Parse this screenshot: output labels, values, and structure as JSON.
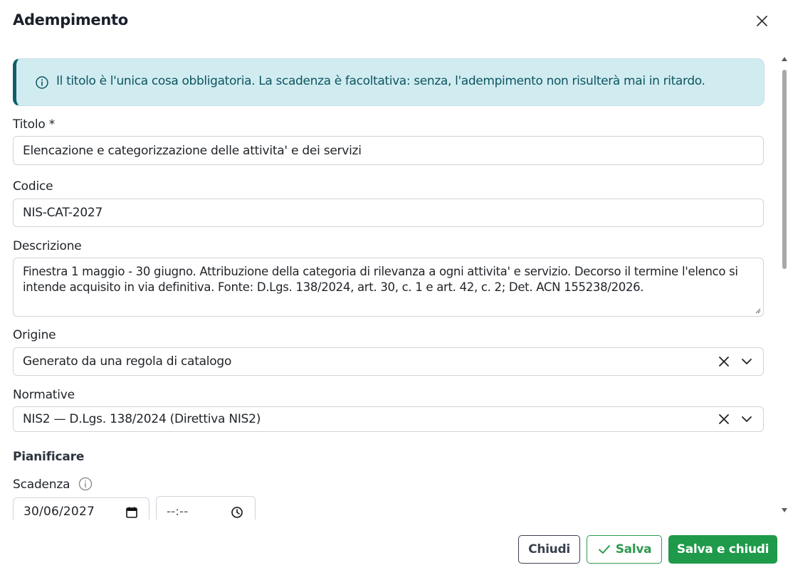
{
  "dialog": {
    "title": "Adempimento"
  },
  "alert": {
    "text": "Il titolo è l'unica cosa obbligatoria. La scadenza è facoltativa: senza, l'adempimento non risulterà mai in ritardo."
  },
  "form": {
    "title_label": "Titolo *",
    "title_value": "Elencazione e categorizzazione delle attivita' e dei servizi",
    "code_label": "Codice",
    "code_value": "NIS-CAT-2027",
    "description_label": "Descrizione",
    "description_value": "Finestra 1 maggio - 30 giugno. Attribuzione della categoria di rilevanza a ogni attivita' e servizio. Decorso il termine l'elenco si intende acquisito in via definitiva. Fonte: D.Lgs. 138/2024, art. 30, c. 1 e art. 42, c. 2; Det. ACN 155238/2026.",
    "origin_label": "Origine",
    "origin_value": "Generato da una regola di catalogo",
    "regulations_label": "Normative",
    "regulations_value": "NIS2 — D.Lgs. 138/2024 (Direttiva NIS2)",
    "plan_section": "Pianificare",
    "deadline_label": "Scadenza",
    "deadline_date": "30/06/2027",
    "deadline_time": "--:--"
  },
  "footer": {
    "close_label": "Chiudi",
    "save_label": "Salva",
    "save_close_label": "Salva e chiudi"
  },
  "icons": {
    "close": "close-icon",
    "info": "info-icon",
    "clear": "clear-icon",
    "chevron": "chevron-down-icon",
    "calendar": "calendar-icon",
    "clock": "clock-icon",
    "check": "check-icon"
  },
  "colors": {
    "alert_bg": "#d1ecf1",
    "alert_text": "#0c5460",
    "primary_green": "#1f9a4a",
    "secondary_green": "#2e9a4f"
  }
}
